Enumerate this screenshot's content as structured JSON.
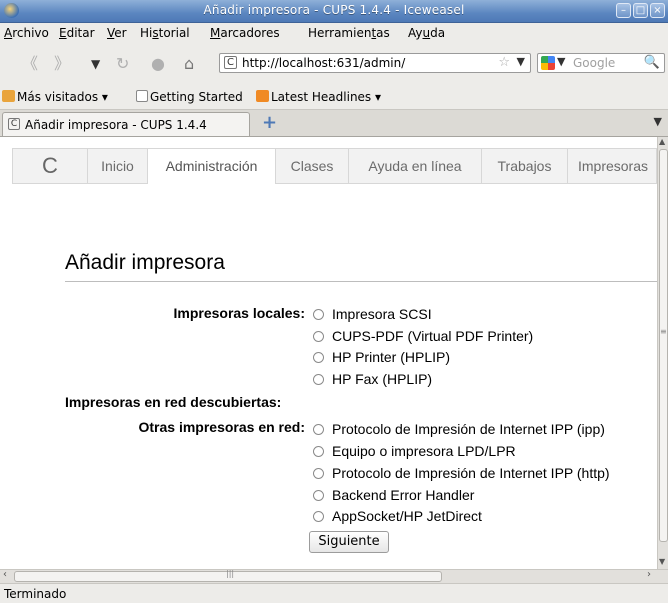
{
  "window": {
    "title": "Añadir impresora - CUPS 1.4.4 - Iceweasel"
  },
  "menu": [
    {
      "pre": "",
      "u": "A",
      "post": "rchivo"
    },
    {
      "pre": "",
      "u": "E",
      "post": "ditar"
    },
    {
      "pre": "",
      "u": "V",
      "post": "er"
    },
    {
      "pre": "Hi",
      "u": "s",
      "post": "torial"
    },
    {
      "pre": "",
      "u": "M",
      "post": "arcadores"
    },
    {
      "pre": "Herramien",
      "u": "t",
      "post": "as"
    },
    {
      "pre": "Ay",
      "u": "u",
      "post": "da"
    }
  ],
  "navigation": {
    "url": "http://localhost:631/admin/",
    "search_placeholder": "Google"
  },
  "bookmarks": [
    {
      "label": "Más visitados ▾",
      "icon": "folder-icon"
    },
    {
      "label": "Getting Started",
      "icon": "page-icon"
    },
    {
      "label": "Latest Headlines ▾",
      "icon": "rss-icon"
    }
  ],
  "tab": {
    "label": "Añadir impresora - CUPS 1.4.4"
  },
  "cups_nav": [
    "Inicio",
    "Administración",
    "Clases",
    "Ayuda en línea",
    "Trabajos",
    "Impresoras"
  ],
  "cups_nav_active": "Administración",
  "page": {
    "title": "Añadir impresora",
    "local_label": "Impresoras locales:",
    "local_printers": [
      "Impresora SCSI",
      "CUPS-PDF (Virtual PDF Printer)",
      "HP Printer (HPLIP)",
      "HP Fax (HPLIP)"
    ],
    "discovered_label": "Impresoras en red descubiertas:",
    "other_label": "Otras impresoras en red:",
    "other_printers": [
      "Protocolo de Impresión de Internet IPP (ipp)",
      "Equipo o impresora LPD/LPR",
      "Protocolo de Impresión de Internet IPP (http)",
      "Backend Error Handler",
      "AppSocket/HP JetDirect"
    ],
    "submit_label": "Siguiente"
  },
  "status": {
    "text": "Terminado"
  }
}
